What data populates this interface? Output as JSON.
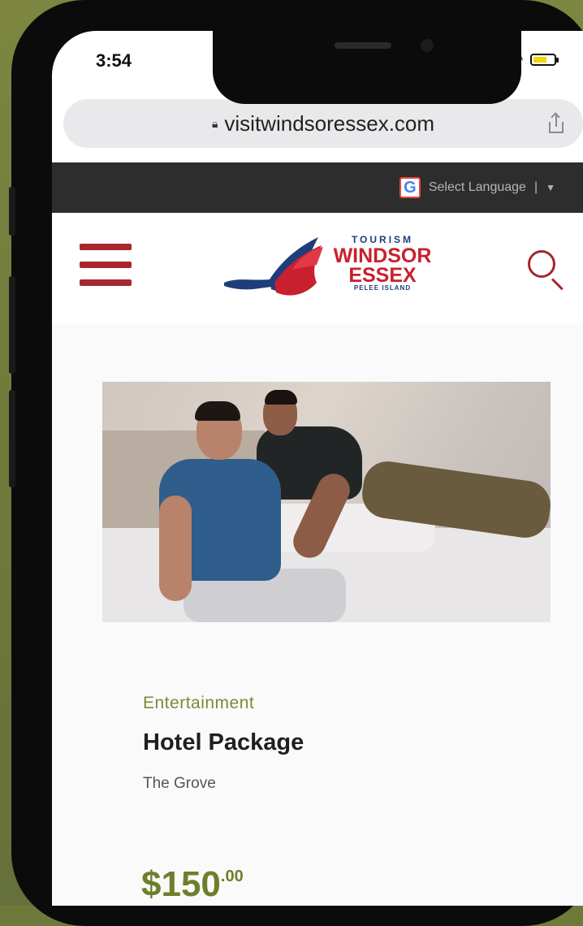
{
  "status_bar": {
    "time": "3:54"
  },
  "browser": {
    "url": "visitwindsoressex.com"
  },
  "language_bar": {
    "label": "Select Language"
  },
  "logo": {
    "tourism": "TOURISM",
    "windsor": "WINDSOR",
    "essex": "ESSEX",
    "pelee": "PELEE ISLAND"
  },
  "listing": {
    "category": "Entertainment",
    "title": "Hotel Package",
    "venue": "The Grove",
    "price_main": "$150",
    "price_cents": ".00"
  },
  "colors": {
    "brand_red": "#a8272f",
    "accent_green": "#6e7f2c",
    "logo_blue": "#1f3d7a"
  }
}
